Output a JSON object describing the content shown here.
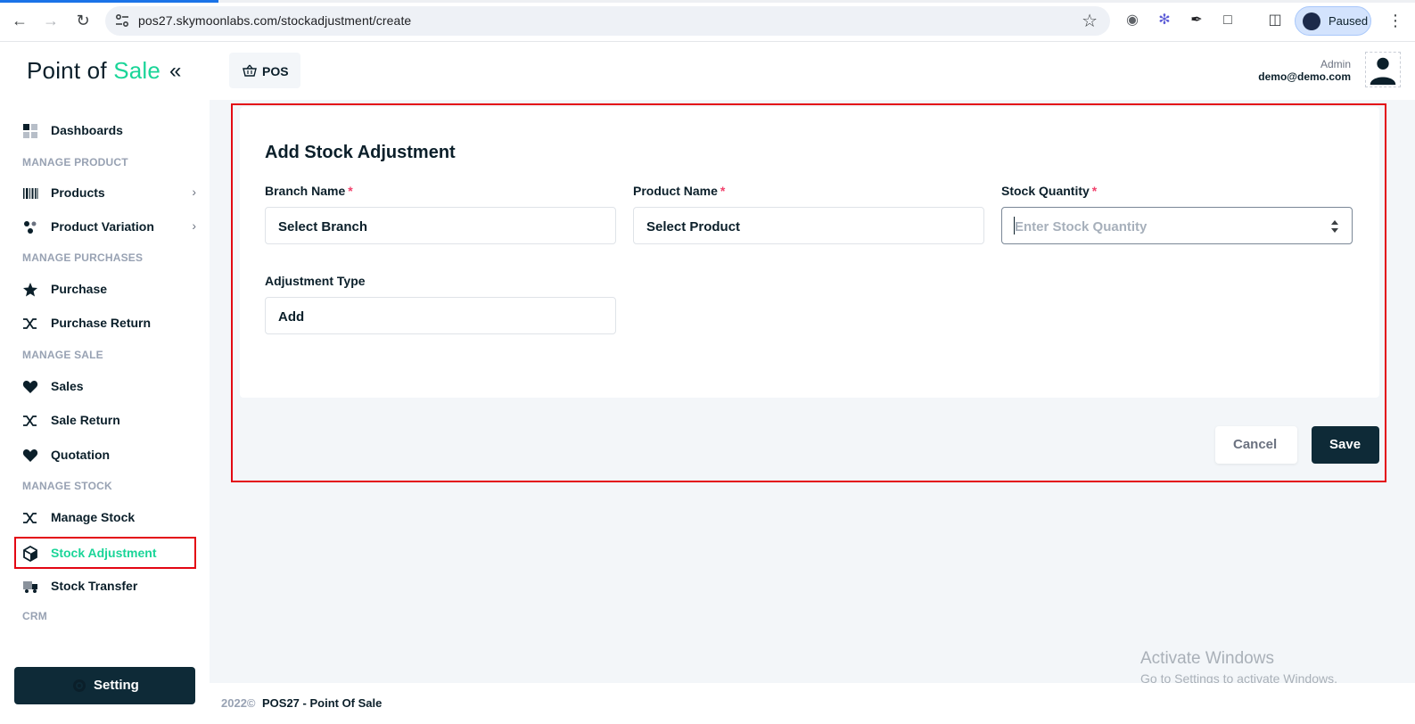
{
  "browser": {
    "url": "pos27.skymoonlabs.com/stockadjustment/create",
    "profile_status": "Paused"
  },
  "sidebar": {
    "brand_prefix": "Point of",
    "brand_accent": "Sale",
    "items": [
      {
        "label": "Dashboards",
        "icon": "dashboard-icon"
      },
      {
        "section": "MANAGE PRODUCT"
      },
      {
        "label": "Products",
        "icon": "barcode-icon",
        "has_children": true
      },
      {
        "label": "Product Variation",
        "icon": "variation-icon",
        "has_children": true
      },
      {
        "section": "MANAGE PURCHASES"
      },
      {
        "label": "Purchase",
        "icon": "star-icon"
      },
      {
        "label": "Purchase Return",
        "icon": "shuffle-icon"
      },
      {
        "section": "MANAGE SALE"
      },
      {
        "label": "Sales",
        "icon": "heart-icon"
      },
      {
        "label": "Sale Return",
        "icon": "shuffle-icon"
      },
      {
        "label": "Quotation",
        "icon": "heart-icon"
      },
      {
        "section": "MANAGE STOCK"
      },
      {
        "label": "Manage Stock",
        "icon": "shuffle-icon"
      },
      {
        "label": "Stock Adjustment",
        "icon": "box-icon",
        "active": true
      },
      {
        "label": "Stock Transfer",
        "icon": "truck-icon"
      },
      {
        "section": "CRM"
      }
    ],
    "setting_label": "Setting"
  },
  "header": {
    "pos_label": "POS",
    "user_role": "Admin",
    "user_email": "demo@demo.com"
  },
  "form": {
    "title": "Add Stock Adjustment",
    "branch": {
      "label": "Branch Name",
      "required": true,
      "value": "Select Branch"
    },
    "product": {
      "label": "Product Name",
      "required": true,
      "value": "Select Product"
    },
    "quantity": {
      "label": "Stock Quantity",
      "required": true,
      "placeholder": "Enter Stock Quantity"
    },
    "adjustment_type": {
      "label": "Adjustment Type",
      "value": "Add"
    },
    "cancel_label": "Cancel",
    "save_label": "Save"
  },
  "overlay": {
    "activate_title": "Activate Windows",
    "activate_sub": "Go to Settings to activate Windows."
  },
  "footer": {
    "year": "2022©",
    "name": "POS27 - Point Of Sale"
  },
  "colors": {
    "accent": "#1ad598",
    "dark": "#0e2a37",
    "required": "#f1416c",
    "highlight": "#e30613"
  }
}
